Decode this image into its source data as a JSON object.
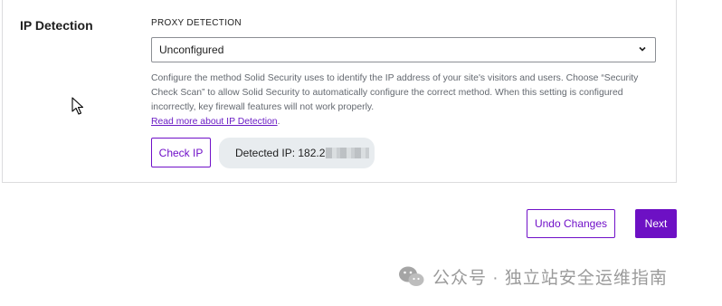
{
  "section": {
    "title": "IP Detection"
  },
  "proxy": {
    "label": "PROXY DETECTION",
    "selected": "Unconfigured",
    "help_text": "Configure the method Solid Security uses to identify the IP address of your site's visitors and users. Choose “Security Check Scan” to allow Solid Security to automatically configure the correct method. When this setting is configured incorrectly, key firewall features will not work properly.",
    "read_more": "Read more about IP Detection",
    "read_more_suffix": "."
  },
  "check": {
    "button_label": "Check IP",
    "detected_prefix": "Detected IP: 182.2"
  },
  "footer": {
    "undo_label": "Undo Changes",
    "next_label": "Next"
  },
  "watermark": {
    "text": "公众号 · 独立站安全运维指南"
  },
  "colors": {
    "accent": "#6d10c4",
    "help_text": "#646970",
    "pill_bg": "#e8ecef"
  },
  "icons": {
    "select": "chevron-down-icon",
    "cursor": "mouse-pointer-icon",
    "watermark": "wechat-icon"
  }
}
